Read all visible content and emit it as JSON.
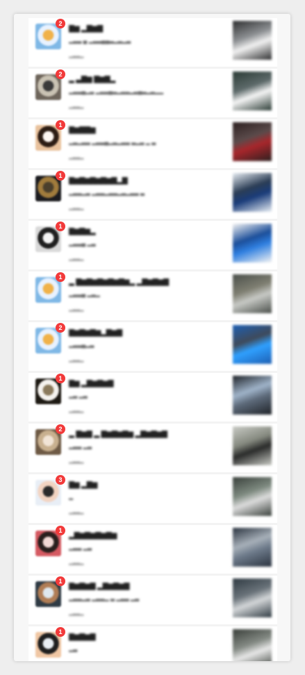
{
  "messages": [
    {
      "badge": "2",
      "title": "▇▆ ▂▇▆▇",
      "snippet": "▂▃▃ ▄ ▂▃▃▄▄▃▂▃▂▃",
      "time": "▂▃▃▂",
      "avatar_colors": [
        "#7fb8e6",
        "#e8f2ff",
        "#f0b24a"
      ],
      "thumb_colors": [
        "#2e2f30",
        "#f1f1f1",
        "#8c8f92"
      ]
    },
    {
      "badge": "2",
      "title": "▂ ▃▇▆ ▇▆▇▂",
      "snippet": "▂▃▃▄▂▃ ▂▃▃▄▃▂▃▃▂▃▄▃▂▃▂▂",
      "time": "▂▃▃▂",
      "avatar_colors": [
        "#6e655b",
        "#c9c2b3",
        "#3a3a3a"
      ],
      "thumb_colors": [
        "#2b3b35",
        "#f5f5f5",
        "#5d6a6a"
      ]
    },
    {
      "badge": "1",
      "title": "▇▆▇▇▆",
      "snippet": "▂▃▂▃▃ ▂▃▃▄▂▃▂▃▃ ▃▂▃ ▂ ▃",
      "time": "▂▃▃▂",
      "avatar_colors": [
        "#e9c29d",
        "#2d1d14",
        "#fef7f2"
      ],
      "thumb_colors": [
        "#2d2020",
        "#a8262b",
        "#5b4b4b"
      ]
    },
    {
      "badge": "1",
      "title": "▇▆▇▆▇▆▇▆▇▂▇",
      "snippet": "▂▃▃▂▃ ▂▃▃▂▃▃▂▃▂▃▃ ▃",
      "time": "▂▃▃▂",
      "avatar_colors": [
        "#1c1c20",
        "#a07b3c",
        "#4a3f2c"
      ],
      "thumb_colors": [
        "#e8eef4",
        "#1a3c7a",
        "#2b3d55"
      ]
    },
    {
      "badge": "1",
      "title": "▇▆▇▆▂",
      "snippet": "▂▃▃▄ ▂▃",
      "time": "▂▃▃▂",
      "avatar_colors": [
        "#d9d9d9",
        "#202020",
        "#f4f4f4"
      ],
      "thumb_colors": [
        "#f3f3f3",
        "#2f7fe0",
        "#1c4f9a"
      ]
    },
    {
      "badge": "1",
      "title": "▂ ▇▆▇▆▇▆▇▆▇▆▂ ▂▇▆▇▆▇",
      "snippet": "▂▃▃▄ ▂▃▂",
      "time": "▂▃▃▂",
      "avatar_colors": [
        "#7fb8e6",
        "#e8f2ff",
        "#f0b24a"
      ],
      "thumb_colors": [
        "#4a4f4a",
        "#c7c9c5",
        "#7f7f72"
      ]
    },
    {
      "badge": "2",
      "title": "▇▆▇▆▇▆▂▇▆▇",
      "snippet": "▂▃▃▄▂▃",
      "time": "▂▃▃▂",
      "avatar_colors": [
        "#7fb8e6",
        "#e8f2ff",
        "#f0b24a"
      ],
      "thumb_colors": [
        "#1d5fb3",
        "#2fa0ff",
        "#3f4a5a"
      ]
    },
    {
      "badge": "1",
      "title": "▇▆ ▂▇▆▇▆▇",
      "snippet": "▂▃ ▂▃",
      "time": "▂▃▃▂",
      "avatar_colors": [
        "#1e1a14",
        "#f5f2ee",
        "#8b7a5c"
      ],
      "thumb_colors": [
        "#1f2328",
        "#5d6a7a",
        "#9fb3c9"
      ]
    },
    {
      "badge": "2",
      "title": "▂ ▇▆▇ ▂ ▇▆▇▆▇▆ ▂▇▆▇▆▇",
      "snippet": "▂▃▃ ▂▃",
      "time": "▂▃▃▂",
      "avatar_colors": [
        "#6e5a45",
        "#c8b08f",
        "#f1e4d6"
      ],
      "thumb_colors": [
        "#c9cbc5",
        "#2a2b2a",
        "#85897f"
      ]
    },
    {
      "badge": "3",
      "title": "▇▆ ▂▇▆",
      "snippet": "▂",
      "time": "▂▃▃▂",
      "avatar_colors": [
        "#e8eef6",
        "#f2d4c2",
        "#2b2b2b"
      ],
      "thumb_colors": [
        "#39403b",
        "#dcdcdc",
        "#7e8a80"
      ]
    },
    {
      "badge": "1",
      "title": "▂▇▆▇▆▇▆▇▆",
      "snippet": "▂▃▃ ▂▃",
      "time": "▂▃▃▂",
      "avatar_colors": [
        "#d55a62",
        "#2a1f1d",
        "#f3d9d5"
      ],
      "thumb_colors": [
        "#2b3440",
        "#6d7a8a",
        "#a7b0b9"
      ]
    },
    {
      "badge": "1",
      "title": "▇▆▇▆▇ ▂▇▆▇▆▇",
      "snippet": "▂▃▃▂▃ ▂▃▃▂ ▃ ▂▃▃ ▂▃",
      "time": "▂▃▃▂",
      "avatar_colors": [
        "#2f3b45",
        "#b07d55",
        "#dfe8ee"
      ],
      "thumb_colors": [
        "#2f3a42",
        "#d3d6d8",
        "#6a737a"
      ]
    },
    {
      "badge": "1",
      "title": "▇▆▇▆▇",
      "snippet": "▂▃",
      "time": "",
      "avatar_colors": [
        "#f0c7a4",
        "#1f1f1f",
        "#e9eef3"
      ],
      "thumb_colors": [
        "#3a3f3a",
        "#e7e7e7",
        "#848a84"
      ]
    }
  ]
}
